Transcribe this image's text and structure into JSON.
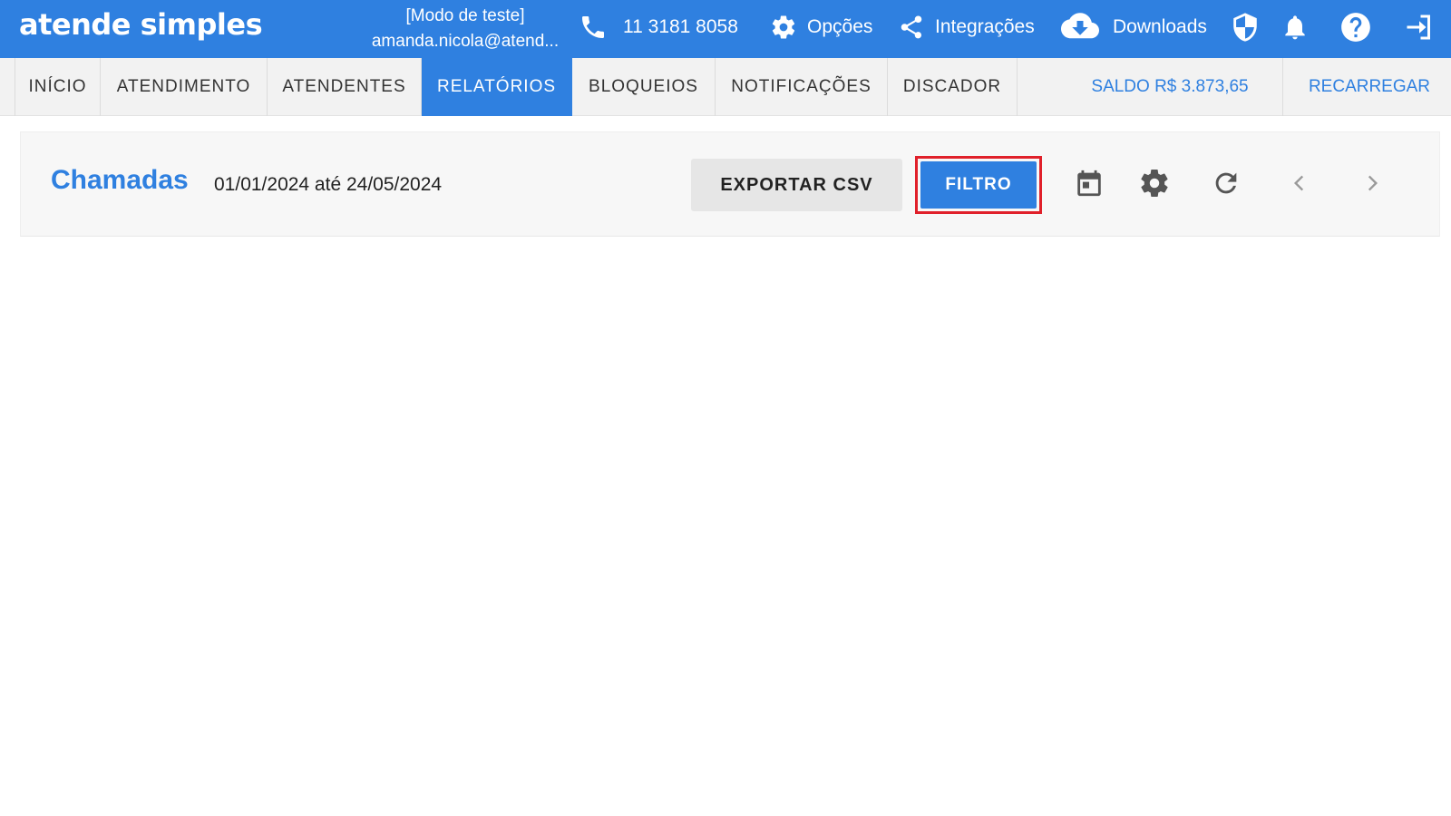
{
  "app": {
    "logo_text": "atende simples",
    "mode_label": "[Modo de teste]",
    "user_email": "amanda.nicola@atend..."
  },
  "topbar": {
    "phone_number": "11 3181 8058",
    "options_label": "Opções",
    "integrations_label": "Integrações",
    "downloads_label": "Downloads",
    "icons": [
      "phone-icon",
      "gear-icon",
      "share-icon",
      "cloud-download-icon",
      "shield-icon",
      "bell-icon",
      "help-icon",
      "logout-icon"
    ]
  },
  "nav": {
    "tabs": [
      {
        "label": "INÍCIO"
      },
      {
        "label": "ATENDIMENTO"
      },
      {
        "label": "ATENDENTES"
      },
      {
        "label": "RELATÓRIOS",
        "active": true
      },
      {
        "label": "BLOQUEIOS"
      },
      {
        "label": "NOTIFICAÇÕES"
      },
      {
        "label": "DISCADOR"
      }
    ],
    "balance": "SALDO R$ 3.873,65",
    "recharge": "RECARREGAR"
  },
  "report": {
    "title": "Chamadas",
    "date_range": "01/01/2024 até 24/05/2024",
    "export_label": "EXPORTAR CSV",
    "filter_label": "FILTRO",
    "icons": [
      "calendar-icon",
      "settings-icon",
      "refresh-icon",
      "chevron-left-icon",
      "chevron-right-icon"
    ]
  },
  "colors": {
    "primary": "#2f80e0",
    "highlight_outline": "#e0202a",
    "nav_background": "#f2f2f2"
  }
}
